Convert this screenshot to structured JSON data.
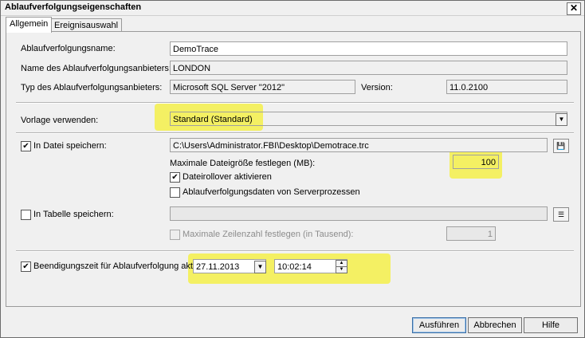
{
  "window": {
    "title": "Ablaufverfolgungseigenschaften",
    "close": "✕"
  },
  "tabs": [
    {
      "label": "Allgemein"
    },
    {
      "label": "Ereignisauswahl"
    }
  ],
  "general": {
    "trace_name_label": "Ablaufverfolgungsname:",
    "trace_name_value": "DemoTrace",
    "provider_name_label": "Name des Ablaufverfolgungsanbieters:",
    "provider_name_value": "LONDON",
    "provider_type_label": "Typ des Ablaufverfolgungsanbieters:",
    "provider_type_value": "Microsoft SQL Server \"2012\"",
    "version_label": "Version:",
    "version_value": "11.0.2100",
    "template_label": "Vorlage verwenden:",
    "template_value": "Standard (Standard)",
    "save_file_label": "In Datei speichern:",
    "save_file_checked": true,
    "file_path": "C:\\Users\\Administrator.FBI\\Desktop\\Demotrace.trc",
    "max_size_label": "Maximale Dateigröße festlegen (MB):",
    "max_size_value": "100",
    "rollover_label": "Dateirollover aktivieren",
    "rollover_checked": true,
    "server_data_label": "Ablaufverfolgungsdaten von Serverprozessen",
    "server_data_checked": false,
    "save_table_label": "In Tabelle speichern:",
    "save_table_checked": false,
    "max_rows_label": "Maximale Zeilenzahl festlegen (in Tausend):",
    "max_rows_value": "1",
    "stop_time_label": "Beendigungszeit für Ablaufverfolgung aktivieren:",
    "stop_time_checked": true,
    "stop_date": "27.11.2013",
    "stop_time": "10:02:14"
  },
  "buttons": {
    "run": "Ausführen",
    "cancel": "Abbrechen",
    "help": "Hilfe"
  },
  "icons": {
    "check": "✔",
    "dropdown": "▼",
    "spin_up": "▲",
    "spin_down": "▼",
    "browse_file": "💾",
    "browse_table": "☰"
  },
  "colors": {
    "highlight": "#f5f04a"
  }
}
